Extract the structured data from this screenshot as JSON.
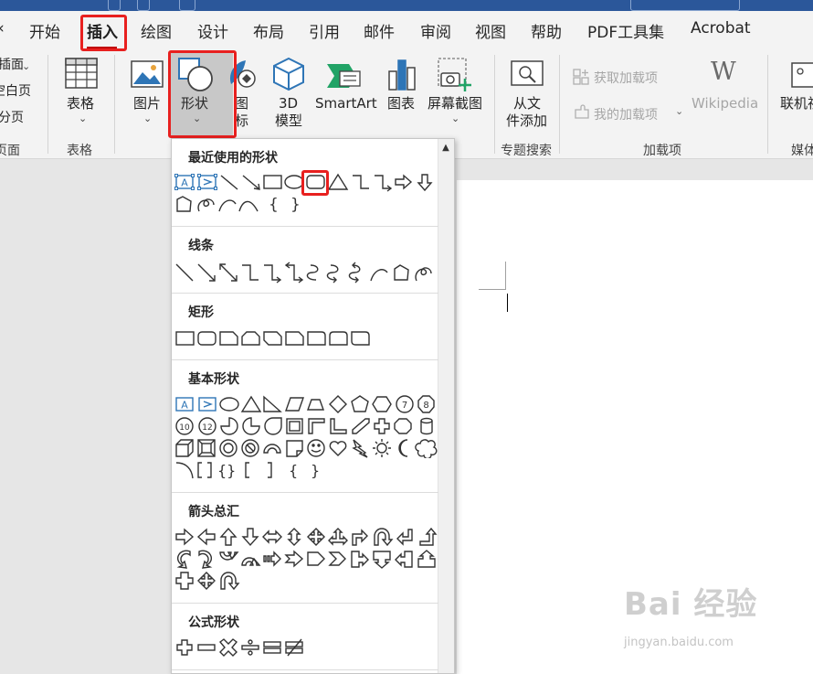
{
  "tabs": [
    "开始",
    "插入",
    "绘图",
    "设计",
    "布局",
    "引用",
    "邮件",
    "审阅",
    "视图",
    "帮助",
    "PDF工具集",
    "Acrobat"
  ],
  "active_tab": "插入",
  "left_partial": [
    "插面",
    "空白页",
    "分页",
    "页面"
  ],
  "ribbon": {
    "table": {
      "label": "表格",
      "group": "表格"
    },
    "picture": {
      "label": "图片"
    },
    "shapes": {
      "label": "形状"
    },
    "icons": {
      "label_line1": "图",
      "label_line2": "标"
    },
    "model3d": {
      "label_line1": "3D",
      "label_line2": "模型"
    },
    "smartart": {
      "label": "SmartArt"
    },
    "chart": {
      "label": "图表"
    },
    "screenshot": {
      "label": "屏幕截图"
    },
    "from_file": {
      "label_line1": "从文",
      "label_line2": "件添加",
      "group": "专题搜索"
    },
    "addins": {
      "get": "获取加载项",
      "mine": "我的加载项",
      "group": "加载项"
    },
    "wikipedia": {
      "label": "Wikipedia",
      "logo": "W"
    },
    "online": {
      "label": "联机视",
      "group": "媒体"
    }
  },
  "shapes_menu": {
    "sections": [
      "最近使用的形状",
      "线条",
      "矩形",
      "基本形状",
      "箭头总汇",
      "公式形状"
    ],
    "text_box_glyph": "A",
    "circle_labels": [
      "7",
      "8",
      "10",
      "12"
    ]
  },
  "watermark": {
    "brand": "Bai 经验",
    "url": "jingyan.baidu.com"
  },
  "colors": {
    "highlight": "#e8201f",
    "titlebar": "#2b579a",
    "accent_blue": "#2e75b6"
  }
}
